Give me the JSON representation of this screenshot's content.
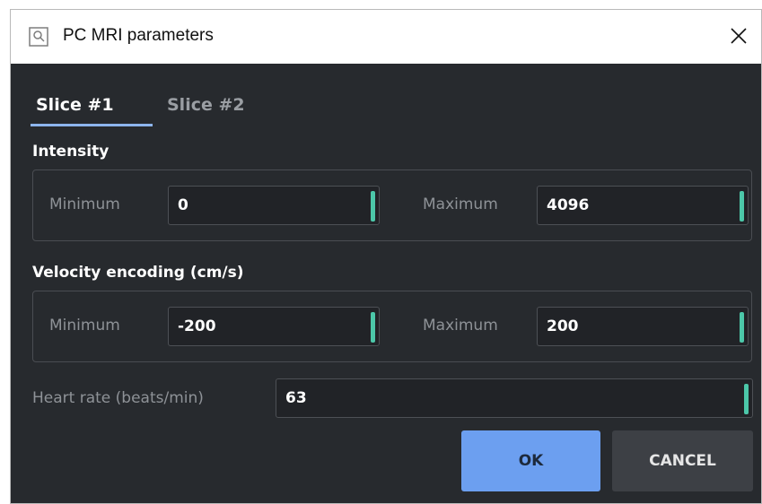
{
  "window": {
    "title": "PC MRI parameters",
    "icon": "image-search-icon",
    "close_icon": "close-icon"
  },
  "tabs": [
    {
      "label": "Slice #1",
      "active": true
    },
    {
      "label": "Slice #2",
      "active": false
    }
  ],
  "intensity": {
    "label": "Intensity",
    "min_label": "Minimum",
    "min_value": "0",
    "max_label": "Maximum",
    "max_value": "4096"
  },
  "velocity": {
    "label": "Velocity encoding (cm/s)",
    "min_label": "Minimum",
    "min_value": "-200",
    "max_label": "Maximum",
    "max_value": "200"
  },
  "heart_rate": {
    "label": "Heart rate (beats/min)",
    "value": "63"
  },
  "buttons": {
    "ok": "OK",
    "cancel": "CANCEL"
  },
  "colors": {
    "background": "#272a2e",
    "accent": "#6c9ff0",
    "spin_handle": "#4cc7a9"
  }
}
